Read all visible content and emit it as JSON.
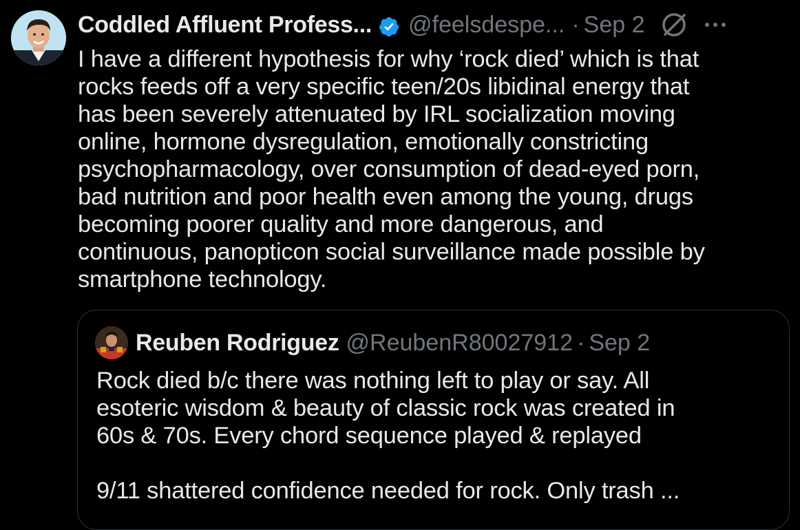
{
  "tweet": {
    "display_name": "Coddled Affluent Profess...",
    "handle": "@feelsdespe...",
    "separator": "·",
    "date": "Sep 2",
    "verified_icon": "verified-badge-icon",
    "verified_color": "#1d9bf0",
    "text_lines": [
      "I have a different hypothesis for why ‘rock died’ which is that",
      "rocks feeds off a very specific teen/20s libidinal energy that",
      "has been severely attenuated by IRL socialization moving",
      "online, hormone dysregulation, emotionally constricting",
      "psychopharmacology, over consumption of dead-eyed porn,",
      "bad nutrition and poor health even among the young, drugs",
      "becoming poorer quality and more dangerous, and",
      "continuous, panopticon social surveillance made possible by",
      "smartphone technology."
    ]
  },
  "quote": {
    "display_name": "Reuben Rodriguez",
    "handle": "@ReubenR80027912",
    "separator": "·",
    "date": "Sep 2",
    "text_lines": [
      "Rock died b/c there was nothing left to play or say. All",
      "esoteric wisdom & beauty of classic rock was created in",
      "60s & 70s. Every chord sequence played & replayed",
      "",
      "9/11 shattered confidence needed for rock. Only trash ..."
    ]
  },
  "icons": {
    "grok": "grok-icon",
    "more": "more-dots-icon"
  },
  "colors": {
    "background": "#000000",
    "text_primary": "#e7e9ea",
    "text_secondary": "#71767b",
    "border": "#2f3336"
  }
}
